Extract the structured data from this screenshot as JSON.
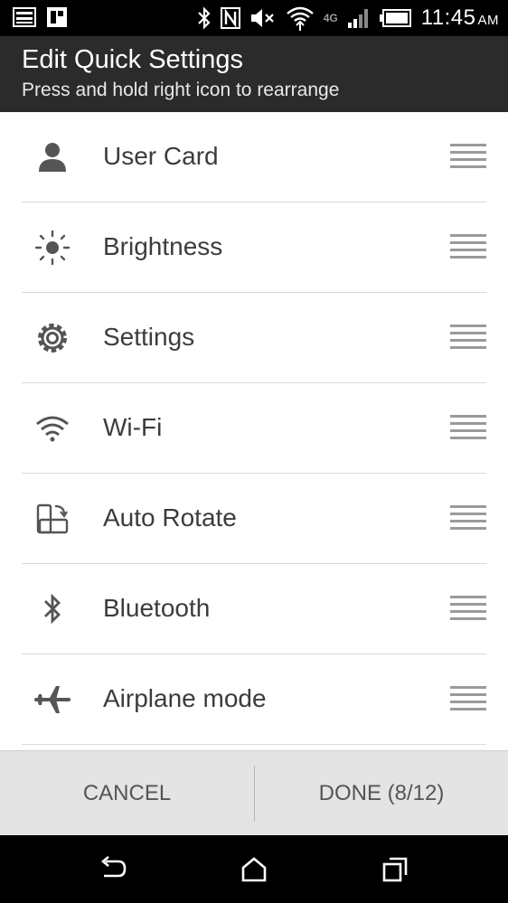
{
  "status_bar": {
    "time": "11:45",
    "ampm": "AM",
    "network_label": "4G"
  },
  "header": {
    "title": "Edit Quick Settings",
    "subtitle": "Press and hold right icon to rearrange"
  },
  "items": [
    {
      "label": "User Card",
      "icon": "user-icon"
    },
    {
      "label": "Brightness",
      "icon": "brightness-icon"
    },
    {
      "label": "Settings",
      "icon": "gear-icon"
    },
    {
      "label": "Wi-Fi",
      "icon": "wifi-icon"
    },
    {
      "label": "Auto Rotate",
      "icon": "auto-rotate-icon"
    },
    {
      "label": "Bluetooth",
      "icon": "bluetooth-icon"
    },
    {
      "label": "Airplane mode",
      "icon": "airplane-icon"
    }
  ],
  "actions": {
    "cancel": "CANCEL",
    "done": "DONE  (8/12)"
  },
  "colors": {
    "title_bar": "#2b2b2b",
    "action_bar": "#e4e4e4",
    "text": "#3c3c3c",
    "icon": "#555555"
  }
}
